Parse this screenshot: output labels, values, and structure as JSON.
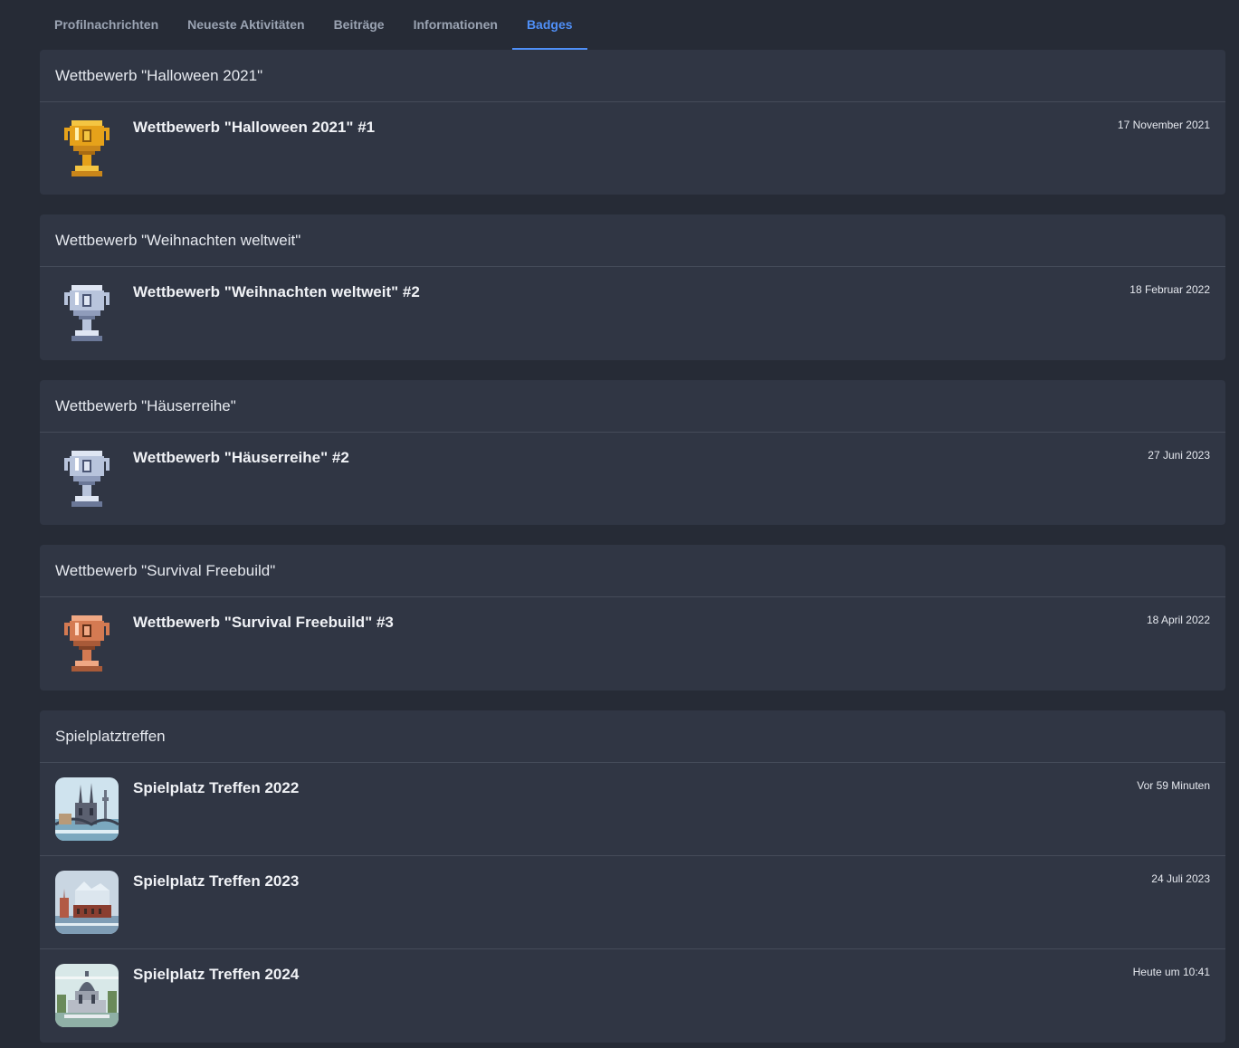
{
  "tabs": [
    {
      "label": "Profilnachrichten"
    },
    {
      "label": "Neueste Aktivitäten"
    },
    {
      "label": "Beiträge"
    },
    {
      "label": "Informationen"
    },
    {
      "label": "Badges",
      "active": true
    }
  ],
  "colors": {
    "page_bg": "#262b36",
    "block_bg": "#303644",
    "accent": "#4f8ff7",
    "gold": "#e6a21a",
    "silver": "#b8c4dc",
    "bronze": "#d47a52"
  },
  "blocks": [
    {
      "header": "Wettbewerb \"Halloween 2021\"",
      "items": [
        {
          "title": "Wettbewerb \"Halloween 2021\" #1",
          "date": "17 November 2021",
          "icon": "gold-trophy-icon"
        }
      ]
    },
    {
      "header": "Wettbewerb \"Weihnachten weltweit\"",
      "items": [
        {
          "title": "Wettbewerb \"Weihnachten weltweit\" #2",
          "date": "18 Februar 2022",
          "icon": "silver-trophy-icon"
        }
      ]
    },
    {
      "header": "Wettbewerb \"Häuserreihe\"",
      "items": [
        {
          "title": "Wettbewerb \"Häuserreihe\" #2",
          "date": "27 Juni 2023",
          "icon": "silver-trophy-icon"
        }
      ]
    },
    {
      "header": "Wettbewerb \"Survival Freebuild\"",
      "items": [
        {
          "title": "Wettbewerb \"Survival Freebuild\" #3",
          "date": "18 April 2022",
          "icon": "bronze-trophy-icon"
        }
      ]
    },
    {
      "header": "Spielplatztreffen",
      "items": [
        {
          "title": "Spielplatz Treffen 2022",
          "date": "Vor 59 Minuten",
          "icon": "cologne-cathedral-icon"
        },
        {
          "title": "Spielplatz Treffen 2023",
          "date": "24 Juli 2023",
          "icon": "hamburg-elbphilharmonie-icon"
        },
        {
          "title": "Spielplatz Treffen 2024",
          "date": "Heute um 10:41",
          "icon": "domed-building-icon"
        }
      ]
    }
  ]
}
